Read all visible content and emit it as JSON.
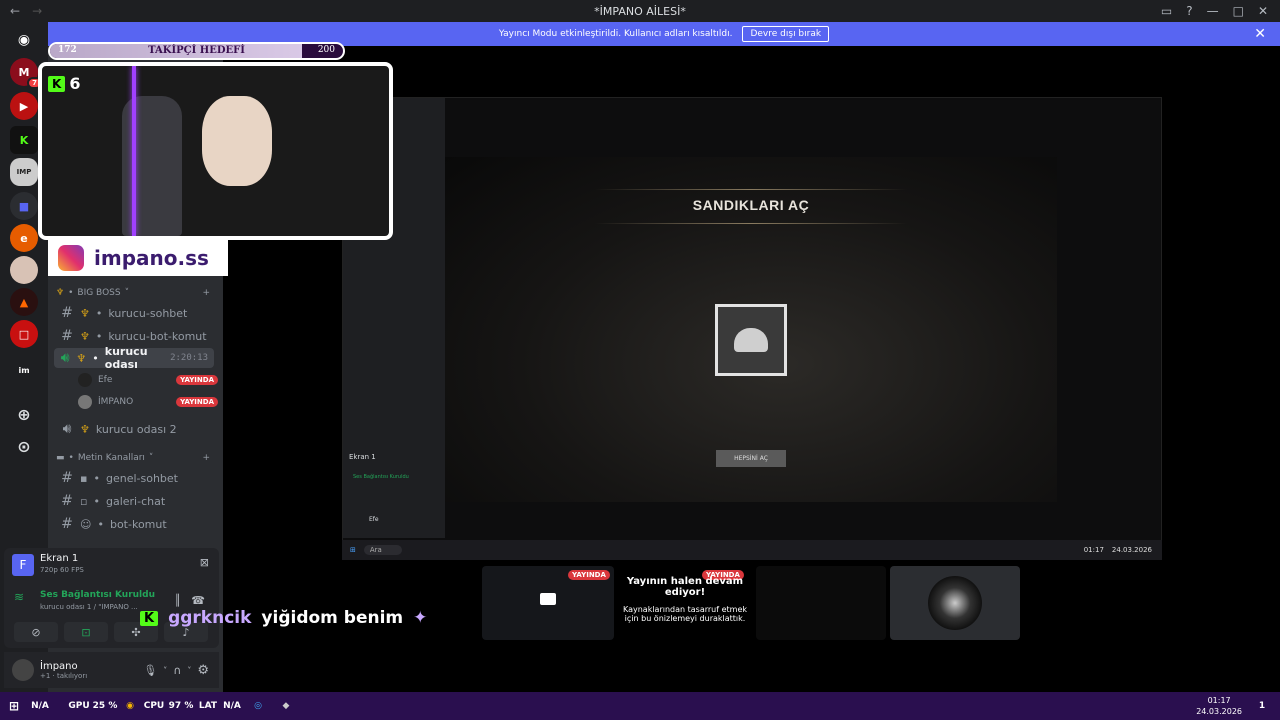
{
  "window": {
    "title": "*İMPANO AİLESİ*"
  },
  "banner": {
    "text": "Yayıncı Modu etkinleştirildi. Kullanıcı adları kısaltıldı.",
    "button": "Devre dışı bırak"
  },
  "guilds": {
    "badges": [
      "7"
    ]
  },
  "overlay": {
    "follow_goal": {
      "current": "172",
      "label": "TAKİPÇİ HEDEFİ",
      "target": "200",
      "progress_fraction": 0.86
    },
    "kick_count": "6",
    "instagram": "impano.ss",
    "chat_user": "ggrkncik",
    "chat_message": "yiğidom benim",
    "server_name": "İMPANO AİLESİ"
  },
  "channels": {
    "cat_big_boss": "BIG BOSS",
    "kurucu_sohbet": "kurucu-sohbet",
    "kurucu_bot_komut": "kurucu-bot-komut",
    "kurucu_odasi": "kurucu odası",
    "voice_time": "2:20:13",
    "voice_users": [
      {
        "name": "Efe",
        "status": "YAYINDA"
      },
      {
        "name": "İMPANO",
        "status": "YAYINDA"
      }
    ],
    "kurucu_odasi_2": "kurucu odası 2",
    "cat_metin": "Metin Kanalları",
    "genel_sohbet": "genel-sohbet",
    "galeri_chat": "galeri-chat",
    "bot_komut": "bot-komut"
  },
  "stream_panel": {
    "title": "Ekran 1",
    "quality": "720p 60 FPS"
  },
  "voice_panel": {
    "status": "Ses Bağlantısı Kuruldu",
    "channel": "kurucu odası 1 / \"İMPANO ..."
  },
  "user": {
    "name": "İmpano",
    "status": "+1 · takılıyorı"
  },
  "game": {
    "title": "SANDIKLARI AÇ",
    "button": "HEPSİNİ AÇ"
  },
  "inner_discord": {
    "channel": "Ekran 1",
    "voice": "Ses Bağlantısı Kuruldu",
    "user": "Efe",
    "search": "Ara",
    "time": "01:17",
    "date": "24.03.2026"
  },
  "stream_thumbs": {
    "live_label": "YAYINDA",
    "pause_title": "Yayının halen devam ediyor!",
    "pause_body": "Kaynaklarından tasarruf etmek için bu önizlemeyi duraklattık."
  },
  "taskbar": {
    "na1": "N/A",
    "gpu": "GPU",
    "gpu_val": "25 %",
    "cpu": "CPU",
    "cpu_val": "97 %",
    "lat": "LAT",
    "lat_val": "N/A",
    "time": "01:17",
    "date": "24.03.2026",
    "notif": "1"
  },
  "colors": {
    "discord_blurple": "#5865f2",
    "live_red": "#da373c",
    "taskbar": "#2a0f4f",
    "kick_green": "#53fc18"
  }
}
